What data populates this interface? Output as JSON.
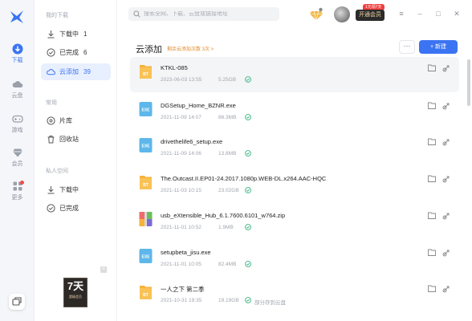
{
  "rail": {
    "items": [
      {
        "label": "下载",
        "icon": "download-icon"
      },
      {
        "label": "云盘",
        "icon": "cloud-icon"
      },
      {
        "label": "游戏",
        "icon": "gamepad-icon"
      },
      {
        "label": "会员",
        "icon": "diamond-icon"
      },
      {
        "label": "更多",
        "icon": "apps-icon"
      }
    ]
  },
  "sidebar": {
    "section1": "我的下载",
    "section2": "常用",
    "section3": "私人空间",
    "items": [
      {
        "label": "下载中",
        "count": "1"
      },
      {
        "label": "已完成",
        "count": "6"
      },
      {
        "label": "云添加",
        "count": "39"
      },
      {
        "label": "片库",
        "count": ""
      },
      {
        "label": "回收站",
        "count": ""
      },
      {
        "label": "下载中",
        "count": ""
      },
      {
        "label": "已完成",
        "count": ""
      }
    ],
    "promo": {
      "big": "7天",
      "small": "超级会员"
    }
  },
  "topbar": {
    "search_placeholder": "搜索全网、下载、云盘或链接地址",
    "vip_tag": "1元领7天",
    "vip_button": "开通会员"
  },
  "main": {
    "title": "云添加",
    "subtitle": "剩余云添加次数 3次 >",
    "new_button": "+ 新建",
    "more_button": "···"
  },
  "files": [
    {
      "name": "KTKL-085",
      "date": "2023-06-03 13:55",
      "size": "5.25GB",
      "status": "",
      "type": "bt"
    },
    {
      "name": "DGSetup_Home_BZNR.exe",
      "date": "2021-11-09 14:07",
      "size": "86.3MB",
      "status": "",
      "type": "exe"
    },
    {
      "name": "drivethelife6_setup.exe",
      "date": "2021-11-09 14:06",
      "size": "13.8MB",
      "status": "",
      "type": "exe"
    },
    {
      "name": "The.Outcast.II.EP01-24.2017.1080p.WEB-DL.x264.AAC-HQC",
      "date": "2021-11-03 10:15",
      "size": "23.02GB",
      "status": "",
      "type": "bt"
    },
    {
      "name": "usb_eXtensible_Hub_6.1.7600.6101_w764.zip",
      "date": "2021-11-01 10:52",
      "size": "1.9MB",
      "status": "",
      "type": "zip"
    },
    {
      "name": "setupbeta_jisu.exe",
      "date": "2021-11-01 10:05",
      "size": "82.4MB",
      "status": "",
      "type": "exe"
    },
    {
      "name": "一人之下 第二季",
      "date": "2021-10-31 19:35",
      "size": "19.19GB",
      "status": "部分存到云盘",
      "type": "bt"
    }
  ],
  "colors": {
    "accent": "#3b74f2",
    "bt": "#f7b23b",
    "exe": "#5db7ea",
    "ok": "#36b37e"
  }
}
